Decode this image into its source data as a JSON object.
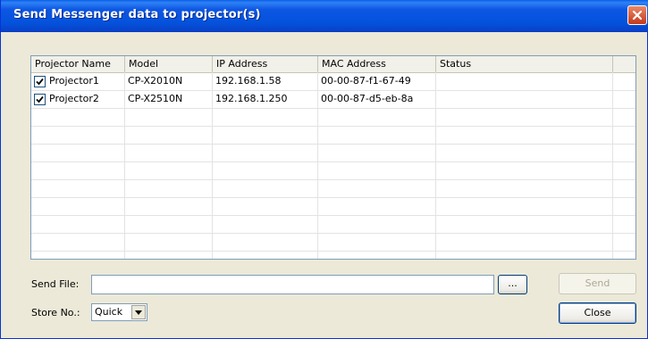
{
  "window": {
    "title": "Send Messenger data to projector(s)"
  },
  "list": {
    "columns": [
      "Projector Name",
      "Model",
      "IP Address",
      "MAC Address",
      "Status"
    ],
    "rows": [
      {
        "checked": true,
        "name": "Projector1",
        "model": "CP-X2010N",
        "ip": "192.168.1.58",
        "mac": "00-00-87-f1-67-49",
        "status": ""
      },
      {
        "checked": true,
        "name": "Projector2",
        "model": "CP-X2510N",
        "ip": "192.168.1.250",
        "mac": "00-00-87-d5-eb-8a",
        "status": ""
      }
    ]
  },
  "send_file": {
    "label": "Send File:",
    "value": "",
    "browse_label": "..."
  },
  "store": {
    "label": "Store No.:",
    "selected": "Quick"
  },
  "buttons": {
    "send": "Send",
    "close": "Close"
  },
  "colors": {
    "titlebar": "#0453dd",
    "close": "#c4391b",
    "face": "#ece9d8"
  }
}
